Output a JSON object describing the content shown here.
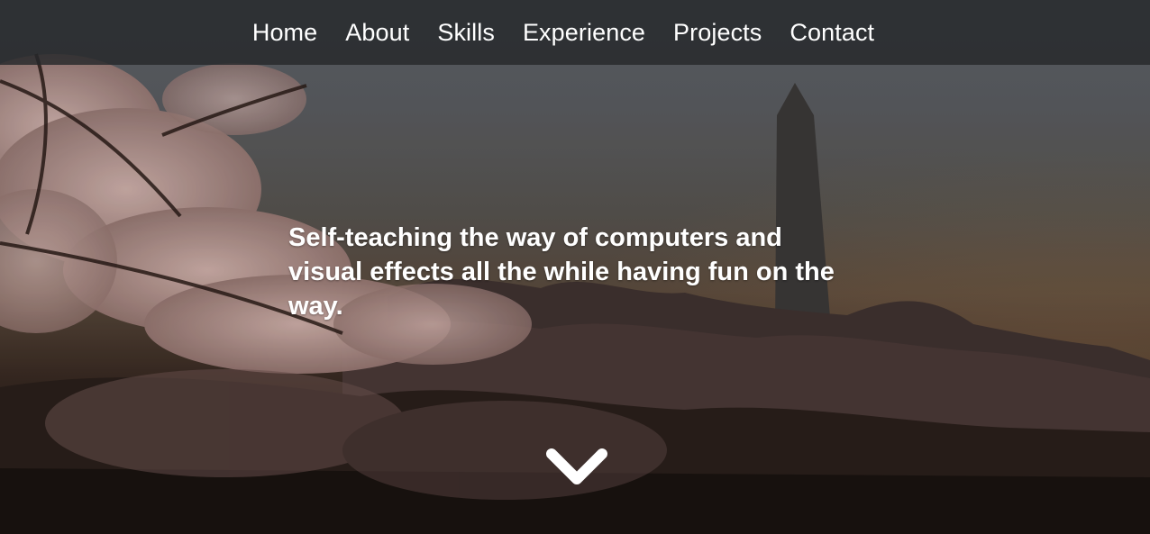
{
  "nav": {
    "items": [
      {
        "label": "Home"
      },
      {
        "label": "About"
      },
      {
        "label": "Skills"
      },
      {
        "label": "Experience"
      },
      {
        "label": "Projects"
      },
      {
        "label": "Contact"
      }
    ]
  },
  "hero": {
    "tagline": "Self-teaching the way of computers and visual effects all the while having fun on the way.",
    "background": "cherry-blossoms-washington-monument-photo",
    "scroll_icon": "chevron-down-icon"
  },
  "colors": {
    "navbar_bg": "#26282b",
    "text": "#ffffff",
    "sky": "#5d6268",
    "blossom": "#c9a6a0"
  }
}
